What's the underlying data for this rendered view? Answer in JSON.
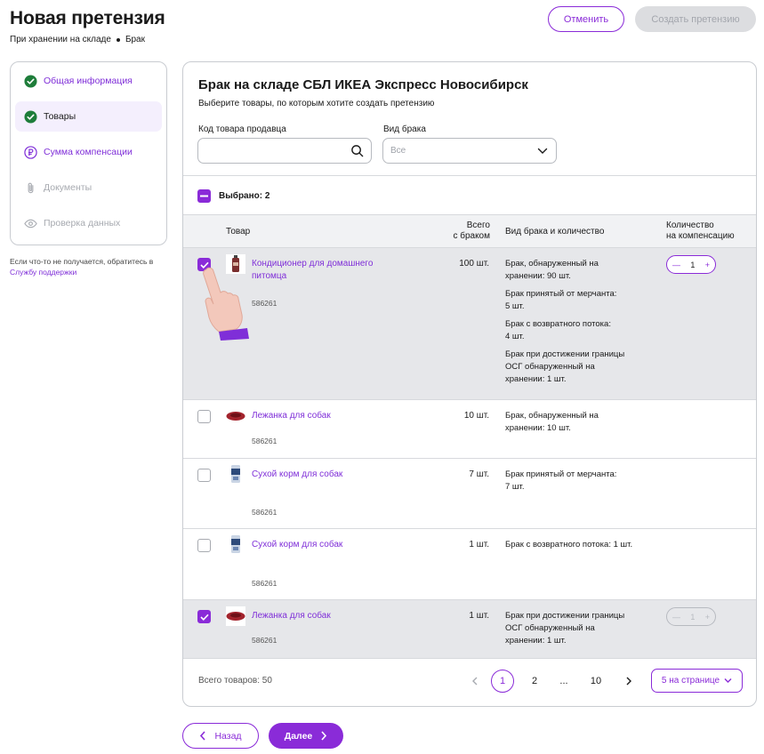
{
  "header": {
    "title": "Новая претензия",
    "crumb_1": "При хранении на складе",
    "crumb_2": "Брак",
    "cancel_label": "Отменить",
    "create_label": "Создать претензию"
  },
  "steps": [
    {
      "label": "Общая информация",
      "icon": "check-circle-icon"
    },
    {
      "label": "Товары",
      "icon": "check-circle-icon"
    },
    {
      "label": "Сумма компенсации",
      "icon": "ruble-icon"
    },
    {
      "label": "Документы",
      "icon": "paperclip-icon"
    },
    {
      "label": "Проверка данных",
      "icon": "eye-icon"
    }
  ],
  "help": {
    "text": "Если что-то не получается, обратитесь в",
    "link": "Службу поддержки"
  },
  "card": {
    "title": "Брак на складе СБЛ ИКЕА Экспресс Новосибирск",
    "subtitle": "Выберите товары, по которым хотите создать претензию",
    "search_label": "Код товара продавца",
    "search_value": "",
    "type_label": "Вид брака",
    "type_value": "Все",
    "selected_text": "Выбрано: 2"
  },
  "table": {
    "col_product": "Товар",
    "col_total_1": "Всего",
    "col_total_2": "с браком",
    "col_defect": "Вид брака и количество",
    "col_comp_1": "Количество",
    "col_comp_2": "на компенсацию",
    "rows": [
      {
        "name_1": "Кондиционер для домашнего",
        "name_2": "питомца",
        "sku": "586261",
        "total": "100 шт.",
        "defect_1": "Брак, обнаруженный на",
        "defect_2": "хранении:",
        "defect_2v": "90 шт.",
        "defect_3": "Брак принятый от мерчанта:",
        "defect_4v": "5 шт.",
        "defect_5": "Брак с возвратного потока:",
        "defect_6v": "4 шт.",
        "defect_7": "Брак при достижении границы",
        "defect_8": "ОСГ обнаруженный на",
        "defect_9": "хранении:",
        "defect_9v": "1 шт.",
        "comp": "1"
      },
      {
        "name_1": "Лежанка для собак",
        "sku": "586261",
        "total": "10 шт.",
        "defect_1": "Брак, обнаруженный на",
        "defect_2": "хранении:",
        "defect_2v": "10 шт."
      },
      {
        "name_1": "Сухой корм для собак",
        "sku": "586261",
        "total": "7 шт.",
        "defect_1": "Брак принятый от мерчанта:",
        "defect_2v": "7 шт."
      },
      {
        "name_1": "Сухой корм для собак",
        "sku": "586261",
        "total": "1 шт.",
        "defect_1": "Брак с возвратного потока:",
        "defect_1v": "1 шт."
      },
      {
        "name_1": "Лежанка для собак",
        "sku": "586261",
        "total": "1 шт.",
        "defect_1": "Брак при достижении границы",
        "defect_2": "ОСГ обнаруженный на",
        "defect_3": "хранении:",
        "defect_3v": "1 шт.",
        "comp": "1"
      }
    ]
  },
  "footer": {
    "total_text": "Всего товаров: 50",
    "pages": [
      "1",
      "2",
      "...",
      "10"
    ],
    "per_page": "5 на странице"
  },
  "nav": {
    "back_label": "Назад",
    "next_label": "Далее"
  },
  "colors": {
    "accent": "#8a2bd8",
    "success": "#1e7d3a",
    "highlight_row": "#e6e7ea"
  }
}
